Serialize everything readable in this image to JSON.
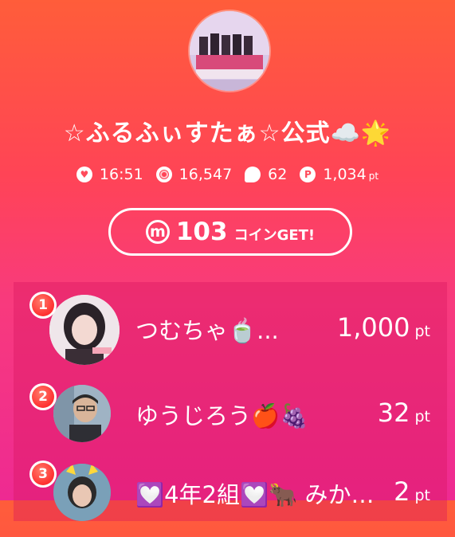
{
  "profile": {
    "title": "☆ふるふぃすたぁ☆公式☁️🌟",
    "avatar_alt": "group-photo"
  },
  "stats": {
    "time": "16:51",
    "views": "16,547",
    "comments": "62",
    "points": "1,034",
    "points_unit": "pt",
    "icons": [
      "heart-icon",
      "target-icon",
      "comment-icon",
      "point-icon"
    ]
  },
  "coin": {
    "icon_letter": "m",
    "amount": "103",
    "label": "コインGET!"
  },
  "ranking": [
    {
      "rank": "1",
      "name": "つむちゃ🍵...",
      "score": "1,000",
      "unit": "pt"
    },
    {
      "rank": "2",
      "name": "ゆうじろう🍎🍇",
      "score": "32",
      "unit": "pt"
    },
    {
      "rank": "3",
      "name": "💟4年2組💟🐂 みか…",
      "score": "2",
      "unit": "pt"
    }
  ],
  "colors": {
    "gradient_top": "#ff5d3a",
    "gradient_bottom": "#ee2a92",
    "badge_red": "#ff3030"
  }
}
